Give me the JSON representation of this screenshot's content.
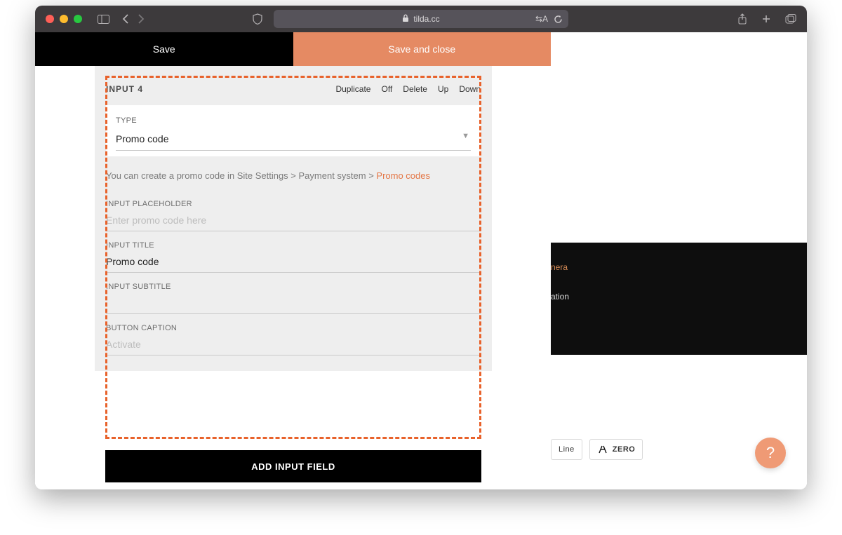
{
  "browser": {
    "url": "tilda.cc"
  },
  "topbar": {
    "save": "Save",
    "save_close": "Save and close"
  },
  "block": {
    "title": "INPUT 4",
    "actions": {
      "duplicate": "Duplicate",
      "off": "Off",
      "delete": "Delete",
      "up": "Up",
      "down": "Down"
    }
  },
  "type_section": {
    "label": "TYPE",
    "value": "Promo code"
  },
  "info": {
    "prefix": "You can create a promo code in Site Settings > Payment system > ",
    "link": "Promo codes"
  },
  "placeholder_field": {
    "label": "INPUT PLACEHOLDER",
    "placeholder": "Enter promo code here"
  },
  "title_field": {
    "label": "INPUT TITLE",
    "value": "Promo code"
  },
  "subtitle_field": {
    "label": "INPUT SUBTITLE",
    "value": ""
  },
  "caption_field": {
    "label": "BUTTON CAPTION",
    "placeholder": "Activate"
  },
  "add_button": "ADD INPUT FIELD",
  "preview": {
    "row_a": "nera",
    "row_b": "ation"
  },
  "chips": {
    "line": "Line",
    "zero": "ZERO"
  },
  "help": "?"
}
